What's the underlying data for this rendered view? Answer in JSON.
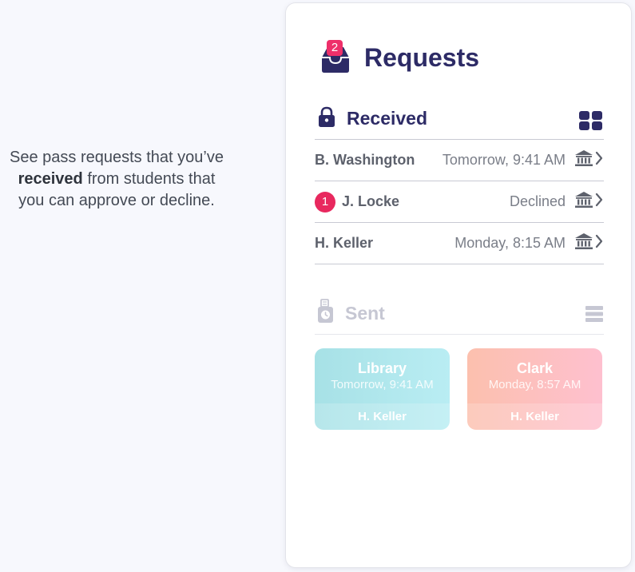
{
  "intro": {
    "line1": "See pass requests that you’ve",
    "bold": "received",
    "line2_rest": " from students that",
    "line3": "you can approve or decline."
  },
  "header": {
    "badge_count": "2",
    "title": "Requests"
  },
  "received": {
    "title": "Received",
    "rows": [
      {
        "name": "B. Washington",
        "status": "Tomorrow, 9:41 AM"
      },
      {
        "badge": "1",
        "name": "J. Locke",
        "status": "Declined"
      },
      {
        "name": "H. Keller",
        "status": "Monday, 8:15 AM"
      }
    ]
  },
  "sent": {
    "title": "Sent",
    "cards": [
      {
        "destination": "Library",
        "time": "Tomorrow, 9:41 AM",
        "student": "H. Keller"
      },
      {
        "destination": "Clark",
        "time": "Monday, 8:57 AM",
        "student": "H. Keller"
      }
    ]
  },
  "colors": {
    "brand_navy": "#2d2b66",
    "badge_pink": "#ee2f6a",
    "tile_teal": "#b2e8ee",
    "tile_peach": "#fdc0bd"
  },
  "icons": [
    "inbox-icon",
    "lock-icon",
    "grid-view-icon",
    "building-icon",
    "chevron-right-icon",
    "pass-icon",
    "list-view-icon"
  ]
}
